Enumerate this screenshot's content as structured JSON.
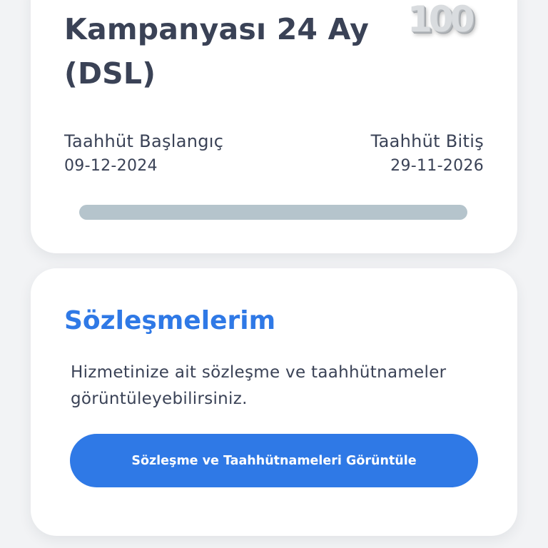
{
  "campaign_card": {
    "title": "Kampanyası 24 Ay (DSL)",
    "badge_text": "100",
    "start_label": "Taahhüt Başlangıç",
    "start_date": "09-12-2024",
    "end_label": "Taahhüt Bitiş",
    "end_date": "29-11-2026",
    "progress_fraction": 0.0
  },
  "contracts_card": {
    "title": "Sözleşmelerim",
    "description": "Hizmetinize ait sözleşme ve taahhütnameler görüntüleyebilirsiniz.",
    "button_label": "Sözleşme ve Taahhütnameleri Görüntüle"
  },
  "colors": {
    "accent": "#2f79e6",
    "text_primary": "#3a4256",
    "progress_track": "#b5c4cc",
    "background": "#f2f3f5",
    "card": "#ffffff"
  },
  "icons": {
    "badge": "100-badge-icon"
  }
}
